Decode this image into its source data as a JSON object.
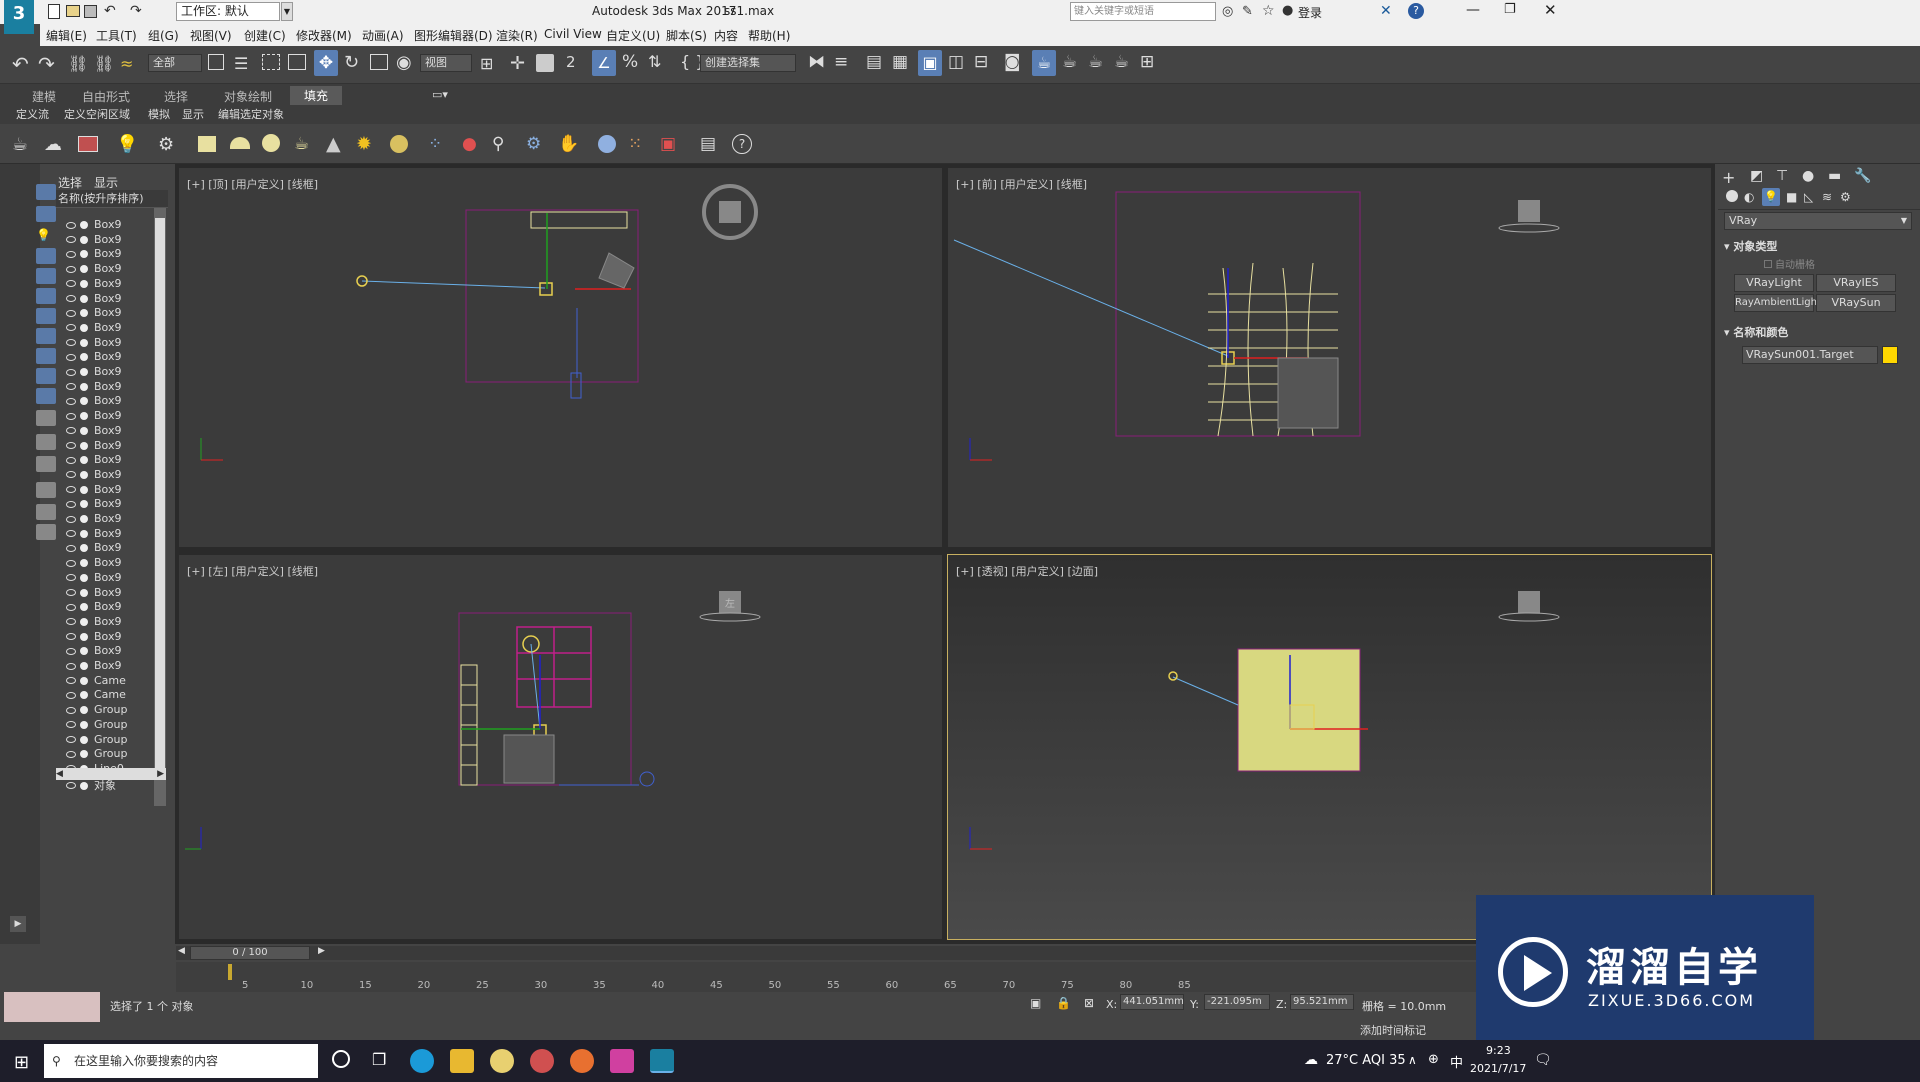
{
  "titlebar": {
    "workspace_label": "工作区: 默认",
    "app_title": "Autodesk 3ds Max 2017",
    "file_name": "ss1.max",
    "search_placeholder": "键入关键字或短语",
    "login_label": "登录",
    "help_label": "?"
  },
  "menu": [
    "编辑(E)",
    "工具(T)",
    "组(G)",
    "视图(V)",
    "创建(C)",
    "修改器(M)",
    "动画(A)",
    "图形编辑器(D)",
    "渲染(R)",
    "Civil View",
    "自定义(U)",
    "脚本(S)",
    "内容",
    "帮助(H)"
  ],
  "toolbar": {
    "filter_label": "全部",
    "view_label": "视图",
    "selection_set_label": "创建选择集",
    "snap_label": "2"
  },
  "ribbon": {
    "tabs": [
      "建模",
      "自由形式",
      "选择",
      "对象绘制",
      "填充"
    ],
    "subtabs": [
      "定义流",
      "定义空闲区域",
      "模拟",
      "显示",
      "编辑选定对象"
    ]
  },
  "scene_explorer": {
    "tabs": [
      "选择",
      "显示"
    ],
    "header": "名称(按升序排序)",
    "rows": [
      "Box9",
      "Box9",
      "Box9",
      "Box9",
      "Box9",
      "Box9",
      "Box9",
      "Box9",
      "Box9",
      "Box9",
      "Box9",
      "Box9",
      "Box9",
      "Box9",
      "Box9",
      "Box9",
      "Box9",
      "Box9",
      "Box9",
      "Box9",
      "Box9",
      "Box9",
      "Box9",
      "Box9",
      "Box9",
      "Box9",
      "Box9",
      "Box9",
      "Box9",
      "Box9",
      "Box9",
      "Came",
      "Came",
      "Group",
      "Group",
      "Group",
      "Group",
      "Line0",
      "对象"
    ]
  },
  "viewports": {
    "top_label": "[+] [顶] [用户定义] [线框]",
    "front_label": "[+] [前] [用户定义] [线框]",
    "left_label": "[+] [左] [用户定义] [线框]",
    "persp_label": "[+] [透视] [用户定义] [边面]",
    "cube_left": "左"
  },
  "command_panel": {
    "renderer": "VRay",
    "object_type_title": "对象类型",
    "autogrid": "自动栅格",
    "buttons": [
      "VRayLight",
      "VRayIES",
      "RayAmbientLigh",
      "VRaySun"
    ],
    "name_color_title": "名称和颜色",
    "object_name": "VRaySun001.Target",
    "object_color": "#ffd700"
  },
  "timeline": {
    "frame_label": "0 / 100",
    "ticks": [
      "5",
      "10",
      "15",
      "20",
      "25",
      "30",
      "35",
      "40",
      "45",
      "50",
      "55",
      "60",
      "65",
      "70",
      "75",
      "80",
      "85"
    ]
  },
  "status": {
    "selection_text": "选择了 1 个 对象",
    "x_label": "X:",
    "x_value": "441.051mm",
    "y_label": "Y:",
    "y_value": "-221.095m",
    "z_label": "Z:",
    "z_value": "95.521mm",
    "grid_label": "栅格 = 10.0mm",
    "add_time_tag": "添加时间标记"
  },
  "taskbar": {
    "search_placeholder": "在这里输入你要搜索的内容",
    "weather": "27°C AQI 35",
    "ime": "中",
    "time": "9:23",
    "date": "2021/7/17"
  },
  "watermark": {
    "brand": "溜溜自学",
    "url": "ZIXUE.3D66.COM"
  }
}
